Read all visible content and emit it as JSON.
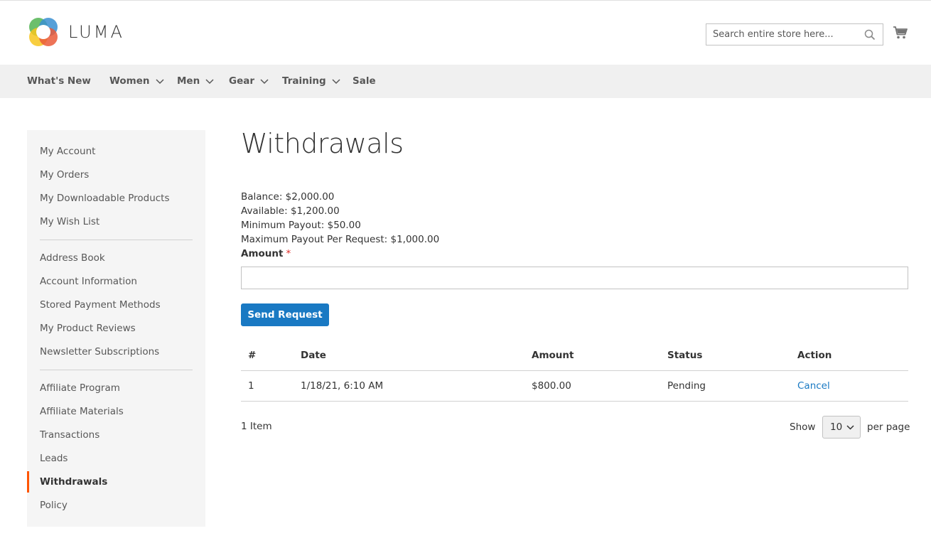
{
  "brand": {
    "name": "LUMA"
  },
  "search": {
    "placeholder": "Search entire store here..."
  },
  "nav": {
    "items": [
      {
        "label": "What's New",
        "has_dropdown": false
      },
      {
        "label": "Women",
        "has_dropdown": true
      },
      {
        "label": "Men",
        "has_dropdown": true
      },
      {
        "label": "Gear",
        "has_dropdown": true
      },
      {
        "label": "Training",
        "has_dropdown": true
      },
      {
        "label": "Sale",
        "has_dropdown": false
      }
    ]
  },
  "sidebar": {
    "groups": [
      [
        "My Account",
        "My Orders",
        "My Downloadable Products",
        "My Wish List"
      ],
      [
        "Address Book",
        "Account Information",
        "Stored Payment Methods",
        "My Product Reviews",
        "Newsletter Subscriptions"
      ],
      [
        "Affiliate Program",
        "Affiliate Materials",
        "Transactions",
        "Leads",
        "Withdrawals",
        "Policy"
      ]
    ],
    "active": "Withdrawals",
    "active_color": "#ff5501"
  },
  "page": {
    "title": "Withdrawals",
    "balance": "Balance: $2,000.00",
    "available": "Available: $1,200.00",
    "minimum_payout": "Minimum Payout: $50.00",
    "maximum_payout": "Maximum Payout Per Request: $1,000.00",
    "amount_label": "Amount",
    "required_mark": "*",
    "amount_value": "",
    "send_button": "Send Request",
    "primary_color": "#1979c3"
  },
  "table": {
    "headers": [
      "#",
      "Date",
      "Amount",
      "Status",
      "Action"
    ],
    "rows": [
      {
        "num": "1",
        "date": "1/18/21, 6:10 AM",
        "amount": "$800.00",
        "status": "Pending",
        "action": "Cancel"
      }
    ]
  },
  "toolbar": {
    "items_count": "1 Item",
    "show_label": "Show",
    "limit_value": "10",
    "per_page_label": "per page"
  }
}
